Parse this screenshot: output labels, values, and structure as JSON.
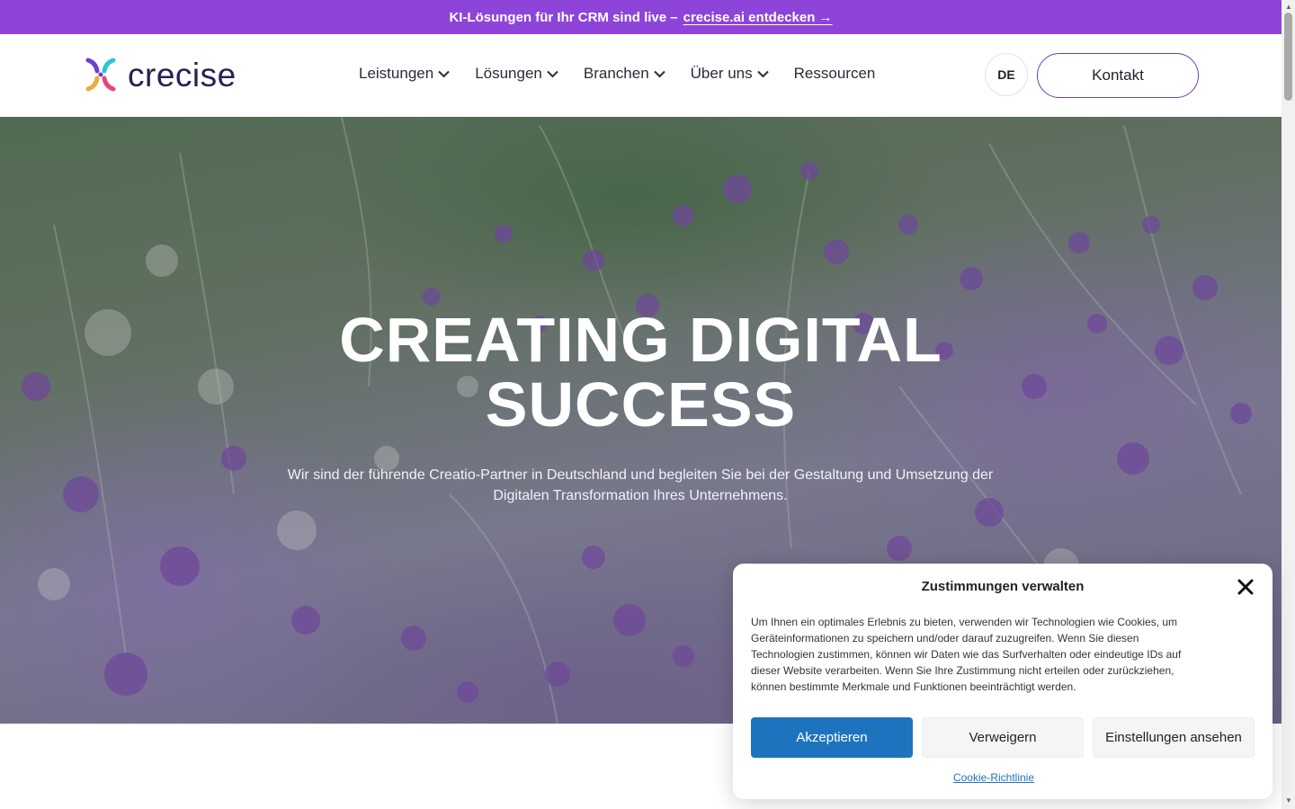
{
  "announcement": {
    "text": "KI-Lösungen für Ihr CRM sind live –",
    "link_label": "crecise.ai entdecken →",
    "background": "#8e44d8"
  },
  "header": {
    "logo_text": "crecise",
    "nav": [
      {
        "label": "Leistungen",
        "has_dropdown": true
      },
      {
        "label": "Lösungen",
        "has_dropdown": true
      },
      {
        "label": "Branchen",
        "has_dropdown": true
      },
      {
        "label": "Über uns",
        "has_dropdown": true
      },
      {
        "label": "Ressourcen",
        "has_dropdown": false
      }
    ],
    "language": "DE",
    "contact_label": "Kontakt"
  },
  "hero": {
    "title_line1": "CREATING DIGITAL",
    "title_line2": "SUCCESS",
    "subtitle_line1": "Wir sind der führende Creatio-Partner in Deutschland und begleiten Sie bei der Gestaltung und Umsetzung der",
    "subtitle_line2": "Digitalen Transformation Ihres Unternehmens."
  },
  "cookie_banner": {
    "title": "Zustimmungen verwalten",
    "text": "Um Ihnen ein optimales Erlebnis zu bieten, verwenden wir Technologien wie Cookies, um Geräteinformationen zu speichern und/oder darauf zuzugreifen. Wenn Sie diesen Technologien zustimmen, können wir Daten wie das Surfverhalten oder eindeutige IDs auf dieser Website verarbeiten. Wenn Sie Ihre Zustimmung nicht erteilen oder zurückziehen, können bestimmte Merkmale und Funktionen beeinträchtigt werden.",
    "accept_label": "Akzeptieren",
    "deny_label": "Verweigern",
    "settings_label": "Einstellungen ansehen",
    "policy_link": "Cookie-Richtlinie",
    "accept_color": "#1e73be"
  },
  "icons": [
    "logo-mark-icon",
    "chevron-down-icon",
    "close-icon"
  ]
}
